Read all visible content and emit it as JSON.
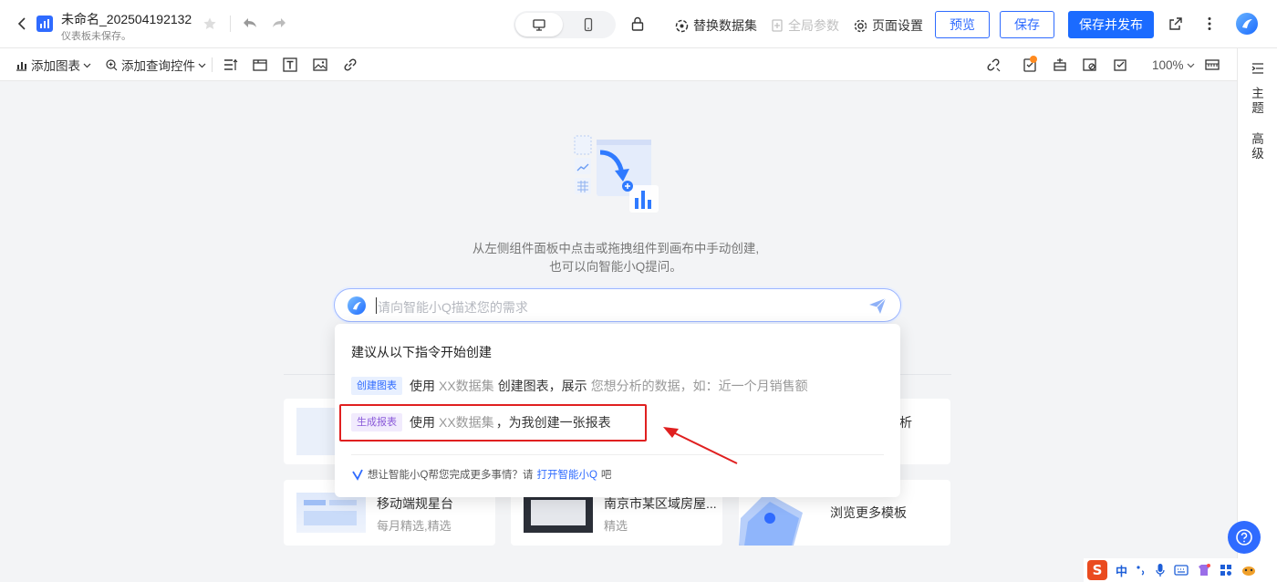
{
  "header": {
    "title": "未命名_202504192132",
    "subtitle": "仪表板未保存。",
    "replace_dataset": "替换数据集",
    "global_params": "全局参数",
    "page_settings": "页面设置",
    "preview": "预览",
    "save": "保存",
    "save_publish": "保存并发布"
  },
  "toolbar": {
    "add_chart": "添加图表",
    "add_query": "添加查询控件",
    "zoom": "100%"
  },
  "right_panel": {
    "theme": "主题",
    "advanced": "高级"
  },
  "canvas": {
    "hint_line1": "从左侧组件面板中点击或拖拽组件到画布中手动创建,",
    "hint_line2": "也可以向智能小Q提问。",
    "ask_placeholder": "请向智能小Q描述您的需求"
  },
  "suggestions": {
    "heading": "建议从以下指令开始创建",
    "items": [
      {
        "tag": "创建图表",
        "p1": "使用",
        "p2": "XX数据集",
        "p3": "创建图表，展示",
        "p4": "您想分析的数据，如：近一个月销售额"
      },
      {
        "tag": "生成报表",
        "p1": "使用",
        "p2": "XX数据集",
        "p3": "，为我创建一张报表",
        "p4": ""
      }
    ],
    "footer_text": "想让智能小Q帮您完成更多事情？请",
    "footer_link": "打开智能小Q",
    "footer_tail": "吧"
  },
  "templates": {
    "right_partial": "析",
    "card1_title": "移动端规星台",
    "card1_sub": "每月精选,精选",
    "card2_title": "南京市某区域房屋...",
    "card2_sub": "精选",
    "card3_title": "浏览更多模板"
  },
  "taskbar": {
    "ime": "中"
  },
  "colors": {
    "primary": "#1b6bff",
    "annotation": "#e02020"
  }
}
